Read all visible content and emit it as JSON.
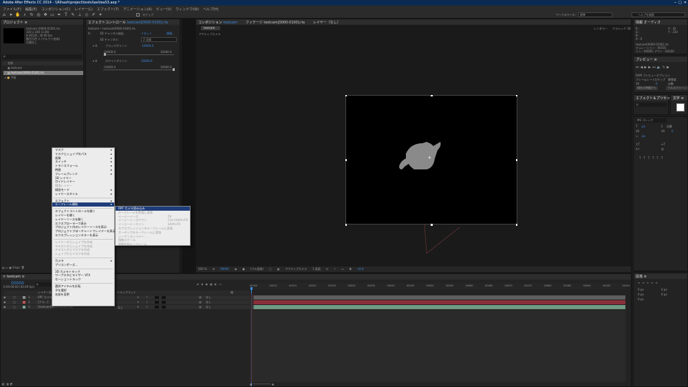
{
  "title": "Adobe After Effects CC 2014 - \\\\Rlhaoh\\project\\testsl\\ae\\teaS3.aep *",
  "menu": [
    "ファイル(F)",
    "編集(E)",
    "コンポジション(C)",
    "レイヤー(L)",
    "エフェクト(T)",
    "アニメーション(A)",
    "ビュー(V)",
    "ウィンドウ(W)",
    "ヘルプ(H)"
  ],
  "toolbar": {
    "snap": "スナップ",
    "workspace_label": "ワークスペース：",
    "workspace": "標準",
    "search": "ヘルプを検索"
  },
  "project": {
    "tab": "プロジェクト ≡",
    "item_name": "testcam [0000-0100].rla",
    "info": [
      "320 x 240 (1.00)",
      "Δ 00101, 30.00 fps",
      "数百万色 + (アルファ合成)",
      "圧縮なし"
    ],
    "search_placeholder": "ρ.",
    "col_name": "名前",
    "items": [
      "testcam",
      "testcam[0000-0100].rla",
      "平面"
    ],
    "bpc": "8 bpc"
  },
  "effects": {
    "tab": "エフェクトコントロール",
    "tab_file": "testcam[0000-0100].rla",
    "breadcrumb": "testcam • testcam[0000-0100].rla",
    "fx_name": "3D チャンネル抽出",
    "reset": "リセット",
    "about": "情報...",
    "channel_label": "3D チャンネル",
    "channel_value": "Z 深度",
    "black_label": "ブラックポイント",
    "black_value": "-10000.0",
    "black_min": "-10000.0",
    "black_max": "10000.0",
    "white_label": "ホワイトポイント",
    "white_value": "10000.0",
    "white_min": "-10000.0",
    "white_max": "10000.0"
  },
  "comp": {
    "tab": "コンポジション",
    "tab_name": "testcam",
    "footage_tab": "フッテージ testcam[0000-0100].rla",
    "layer_tab": "レイヤー（なし）",
    "subtab": "testcam",
    "camera": "アクティブカメラ",
    "renderer": "レンダラー",
    "renderer_value": "クラシック 3D",
    "zoom": "200 %",
    "time": "00000",
    "resolution": "(フル画質)",
    "view": "アクティブカメラ",
    "views": "1 画面",
    "exposure": "+0.0"
  },
  "info": {
    "r": "R :",
    "g": "G :",
    "b": "B :",
    "a": "A : 0",
    "x": "X : 42",
    "y": "Y : 310",
    "footage": "testcam[0000-0100].rla",
    "duration": "デュレーション : 00101",
    "inout": "イン : 00000, アウト : 00100"
  },
  "preview": {
    "tab": "プレビュー ≡",
    "ram_options": "RAM プレビューオプション",
    "frame_rate_label": "フレームレート",
    "skip_label": "スキップ",
    "resolution_label": "解像度",
    "frame_rate": "30",
    "skip": "0",
    "resolution": "自動",
    "from_current": "現在の時間から",
    "fullscreen": "フルスクリーン"
  },
  "effects_presets": {
    "tab": "エフェクト＆プリセット",
    "search": "ρ."
  },
  "character": {
    "tab": "文字 ≡",
    "font": "MS ゴシック",
    "size": "px",
    "leading": "自動",
    "tracking": "0",
    "indent": "px"
  },
  "paragraph": {
    "tab": "段落 ≡",
    "indent_values": [
      "0 px",
      "0 px",
      "0 px",
      "0 px",
      "0 px"
    ]
  },
  "timeline": {
    "tab": "testcam",
    "timecode": "00000",
    "fps": "0:00:00:00 (30.00 fps)",
    "search": "ρ.",
    "col_layer": "レイヤー名",
    "col_track": "トラックマット",
    "col_parent": "親",
    "layers": [
      {
        "num": "1",
        "name": "RPF カメラ",
        "parent": "なし",
        "color": "#8f8f8f"
      },
      {
        "num": "2",
        "name": "[クラ...]",
        "parent": "なし",
        "color": "#c05050"
      },
      {
        "num": "3",
        "name": "[testcam[0000-0100].rla]",
        "parent": "なし",
        "color": "#7aa892"
      }
    ],
    "track_none": "なし",
    "ticks": [
      "00000",
      "00010",
      "00015",
      "00020",
      "00025",
      "00030",
      "00035",
      "00040",
      "00045",
      "00050",
      "00055",
      "00060",
      "00065",
      "00070",
      "00075",
      "00080",
      "00085",
      "00090",
      "00095",
      "00100"
    ],
    "toggle": "スイッチ / モード"
  },
  "context_menu": {
    "items": [
      {
        "label": "マスク",
        "arrow": true
      },
      {
        "label": "マスクとシェイプのパス",
        "arrow": true
      },
      {
        "label": "画質",
        "arrow": true
      },
      {
        "label": "スイッチ",
        "arrow": true
      },
      {
        "label": "トランスフォーム",
        "arrow": true
      },
      {
        "label": "時間",
        "arrow": true
      },
      {
        "label": "フレームブレンド",
        "arrow": true
      },
      {
        "label": "3D レイヤー"
      },
      {
        "label": "ガイドレイヤー"
      },
      {
        "label": "環境レイヤー",
        "disabled": true
      },
      {
        "label": "描画モード",
        "arrow": true
      },
      {
        "label": "レイヤースタイル",
        "arrow": true
      },
      {
        "sep": true
      },
      {
        "label": "エフェクト",
        "arrow": true
      },
      {
        "label": "キーフレーム補助",
        "arrow": true,
        "selected": true
      },
      {
        "sep": true
      },
      {
        "label": "エフェクトコントロールを開く"
      },
      {
        "label": "レイヤーを開く"
      },
      {
        "label": "レイヤーソースを開く"
      },
      {
        "label": "エクスプローラーで表示"
      },
      {
        "label": "プロジェクト内のレイヤーソースを表示"
      },
      {
        "label": "プロジェクトフローチャートでレイヤーを表示"
      },
      {
        "label": "エクスプレッションエラーを表示"
      },
      {
        "sep": true
      },
      {
        "label": "レイヤーからシェイプを作成",
        "disabled": true
      },
      {
        "label": "テキストからシェイプを作成",
        "disabled": true
      },
      {
        "label": "テキストからマスクを作成",
        "disabled": true
      },
      {
        "label": "シェイプからマスクを作成",
        "disabled": true
      },
      {
        "sep": true
      },
      {
        "label": "カメラ",
        "arrow": true
      },
      {
        "label": "プリコンポーズ..."
      },
      {
        "sep": true
      },
      {
        "label": "3D カメラトラック"
      },
      {
        "label": "ワープスタビライザー VFX"
      },
      {
        "label": "モーショントラック"
      },
      {
        "sep": true
      },
      {
        "label": "選択アイテムを反転"
      },
      {
        "label": "子を選択"
      },
      {
        "label": "名前を変更"
      }
    ]
  },
  "submenu": {
    "items": [
      {
        "label": "RPF カメラ読み込み",
        "selected": true
      },
      {
        "label": "キーフレームを等速に変換",
        "disabled": true
      },
      {
        "label": "イージーイーズ",
        "shortcut": "F9",
        "disabled": true
      },
      {
        "label": "イージーイーズアウト",
        "shortcut": "Ctrl+Shift+F9",
        "disabled": true
      },
      {
        "label": "イージーイーズイン",
        "shortcut": "Shift+F9",
        "disabled": true
      },
      {
        "label": "エクスプレッションをキーフレームに変換",
        "disabled": true
      },
      {
        "label": "オーディオをキーフレームに変換",
        "disabled": true
      },
      {
        "label": "シーケンスレイヤー...",
        "disabled": true
      },
      {
        "label": "指数スケール",
        "disabled": true
      },
      {
        "label": "時間反転キーフレーム",
        "disabled": true
      }
    ]
  }
}
